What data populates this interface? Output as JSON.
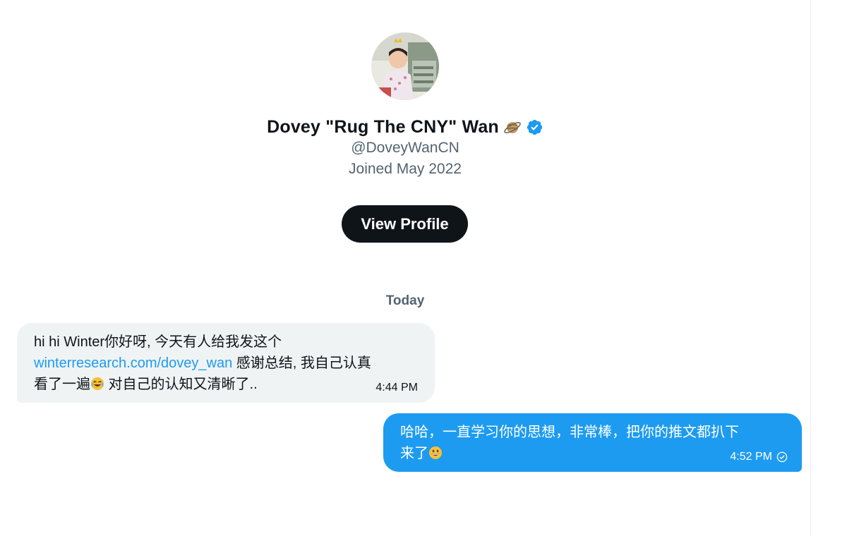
{
  "profile": {
    "display_name": "Dovey \"Rug The CNY\" Wan",
    "handle": "@DoveyWanCN",
    "joined": "Joined May 2022",
    "view_profile_label": "View Profile"
  },
  "conversation": {
    "date_separator": "Today",
    "messages": [
      {
        "direction": "incoming",
        "line1": "hi hi Winter你好呀, 今天有人给我发这个",
        "link": "winterresearch.com/dovey_wan",
        "line2_after_link": " 感谢总结, 我自己认真",
        "line3_before_emoji": "看了一遍",
        "line3_after_emoji": " 对自己的认知又清晰了..",
        "time": "4:44 PM"
      },
      {
        "direction": "outgoing",
        "line1": "哈哈，一直学习你的思想，非常棒，把你的推文都扒下",
        "line2": "来了",
        "time": "4:52 PM"
      }
    ]
  },
  "icons": {
    "name_emoji": "ringed-planet-icon",
    "verified": "verified-badge-icon",
    "msg1_emoji": "tears-of-joy-emoji-icon",
    "msg2_emoji": "grinning-face-emoji-icon",
    "read_status": "sent-check-icon"
  },
  "colors": {
    "accent": "#1d9bf0",
    "primary_text": "#0f1419",
    "secondary_text": "#536471",
    "incoming_bubble": "#eff3f4"
  }
}
